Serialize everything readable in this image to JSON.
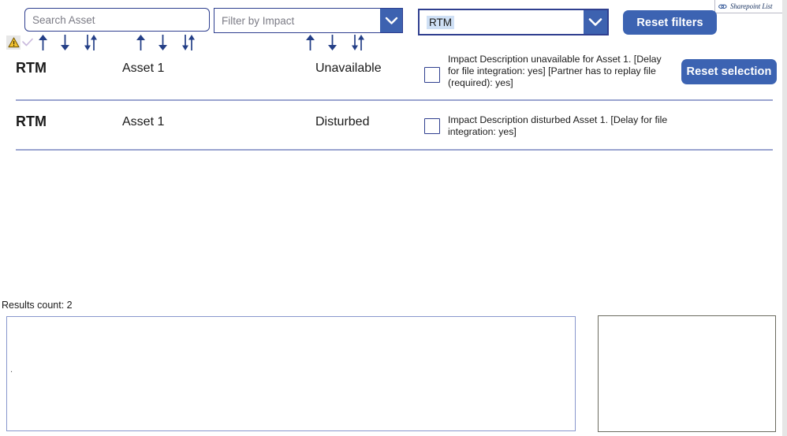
{
  "sharepoint_chip": {
    "label": "Sharepoint List",
    "icon": "link-chain-icon"
  },
  "filters": {
    "search": {
      "placeholder": "Search Asset",
      "value": ""
    },
    "impact_dropdown": {
      "placeholder": "Filter by Impact",
      "value": "",
      "icon": "chevron-down-icon"
    },
    "scope_dropdown": {
      "value": "RTM",
      "icon": "chevron-down-icon",
      "selected_highlight": true
    },
    "reset_filters_label": "Reset filters"
  },
  "actions": {
    "reset_selection_label": "Reset selection"
  },
  "sorters": [
    {
      "column": "asset-id",
      "icons": [
        "warning-triangle-icon",
        "check-icon",
        "sort-ascending-icon",
        "sort-descending-icon",
        "sort-both-icon"
      ]
    },
    {
      "column": "asset-name",
      "icons": [
        "sort-ascending-icon",
        "sort-descending-icon",
        "sort-both-icon"
      ]
    },
    {
      "column": "impact",
      "icons": [
        "sort-ascending-icon",
        "sort-descending-icon",
        "sort-both-icon"
      ]
    }
  ],
  "rows": [
    {
      "asset_id": "RTM",
      "asset_name": "Asset 1",
      "impact": "Unavailable",
      "description": "Impact Description unavailable for Asset 1. [Delay for file integration: yes] [Partner has to replay file (required): yes]",
      "checked": false
    },
    {
      "asset_id": "RTM",
      "asset_name": "Asset 1",
      "impact": "Disturbed",
      "description": "Impact Description disturbed Asset 1. [Delay for file integration: yes]",
      "checked": false
    }
  ],
  "footer": {
    "results_count_label": "Results count: 2",
    "left_panel_text": ".",
    "right_panel_text": ""
  },
  "colors": {
    "accent_blue": "#3c63b2",
    "border_navy": "#2f3f8f",
    "divider": "#9aa4d0",
    "warning_yellow": "#f2c230",
    "selection_highlight": "#cfe0f5"
  }
}
